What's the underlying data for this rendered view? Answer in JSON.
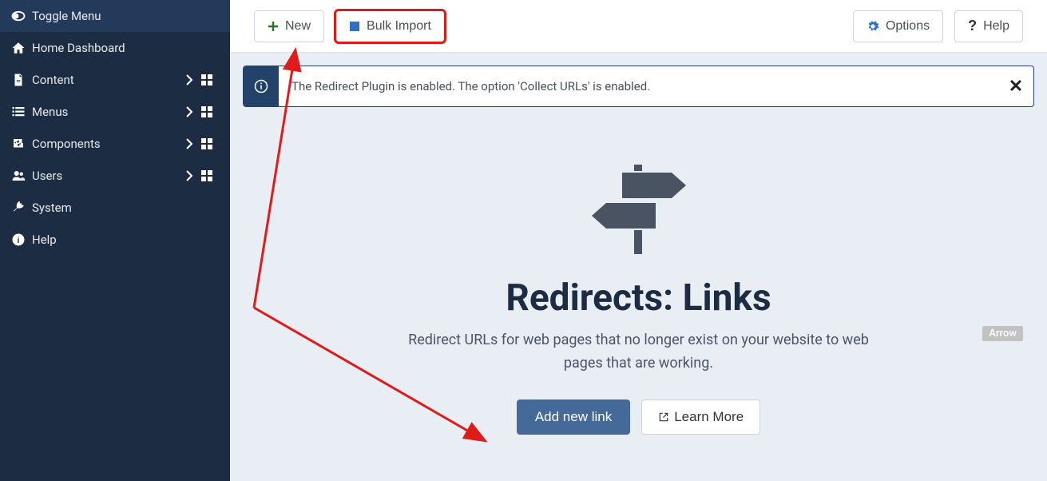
{
  "sidebar": {
    "items": [
      {
        "label": "Toggle Menu"
      },
      {
        "label": "Home Dashboard"
      },
      {
        "label": "Content"
      },
      {
        "label": "Menus"
      },
      {
        "label": "Components"
      },
      {
        "label": "Users"
      },
      {
        "label": "System"
      },
      {
        "label": "Help"
      }
    ]
  },
  "toolbar": {
    "new_label": "New",
    "bulk_import_label": "Bulk Import",
    "options_label": "Options",
    "help_label": "Help"
  },
  "alert": {
    "text": "The Redirect Plugin is enabled. The option 'Collect URLs' is enabled."
  },
  "hero": {
    "title": "Redirects: Links",
    "description": "Redirect URLs for web pages that no longer exist on your website to web pages that are working.",
    "add_label": "Add new link",
    "learn_label": "Learn More"
  },
  "arrow_badge": "Arrow"
}
